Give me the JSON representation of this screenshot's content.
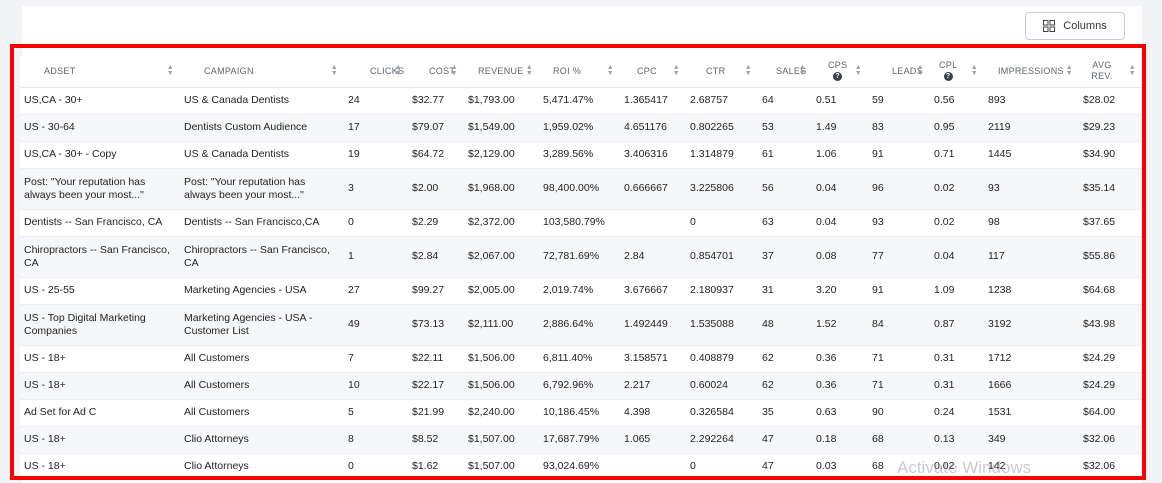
{
  "toolbar": {
    "columns_label": "Columns"
  },
  "watermark": "Activate Windows",
  "table": {
    "headers": {
      "adset": "ADSET",
      "campaign": "CAMPAIGN",
      "clicks": "CLICKS",
      "cost": "COST",
      "revenue": "REVENUE",
      "roi": "ROI %",
      "cpc": "CPC",
      "ctr": "CTR",
      "sales": "SALES",
      "cps": "CPS",
      "leads": "LEADS",
      "cpl": "CPL",
      "impressions": "IMPRESSIONS",
      "avg_rev": "AVG REV."
    },
    "rows": [
      {
        "adset": "US,CA - 30+",
        "campaign": "US & Canada Dentists",
        "clicks": "24",
        "cost": "$32.77",
        "revenue": "$1,793.00",
        "roi": "5,471.47%",
        "cpc": "1.365417",
        "ctr": "2.68757",
        "sales": "64",
        "cps": "0.51",
        "leads": "59",
        "cpl": "0.56",
        "impressions": "893",
        "avg_rev": "$28.02"
      },
      {
        "adset": "US - 30-64",
        "campaign": "Dentists Custom Audience",
        "clicks": "17",
        "cost": "$79.07",
        "revenue": "$1,549.00",
        "roi": "1,959.02%",
        "cpc": "4.651176",
        "ctr": "0.802265",
        "sales": "53",
        "cps": "1.49",
        "leads": "83",
        "cpl": "0.95",
        "impressions": "2119",
        "avg_rev": "$29.23"
      },
      {
        "adset": "US,CA - 30+ - Copy",
        "campaign": "US & Canada Dentists",
        "clicks": "19",
        "cost": "$64.72",
        "revenue": "$2,129.00",
        "roi": "3,289.56%",
        "cpc": "3.406316",
        "ctr": "1.314879",
        "sales": "61",
        "cps": "1.06",
        "leads": "91",
        "cpl": "0.71",
        "impressions": "1445",
        "avg_rev": "$34.90"
      },
      {
        "adset": "Post: \"Your reputation has always been your most...\"",
        "campaign": "Post: \"Your reputation has always been your most...\"",
        "clicks": "3",
        "cost": "$2.00",
        "revenue": "$1,968.00",
        "roi": "98,400.00%",
        "cpc": "0.666667",
        "ctr": "3.225806",
        "sales": "56",
        "cps": "0.04",
        "leads": "96",
        "cpl": "0.02",
        "impressions": "93",
        "avg_rev": "$35.14",
        "tall": true
      },
      {
        "adset": "Dentists -- San Francisco, CA",
        "campaign": "Dentists -- San Francisco,CA",
        "clicks": "0",
        "cost": "$2.29",
        "revenue": "$2,372.00",
        "roi": "103,580.79%",
        "cpc": "",
        "ctr": "0",
        "sales": "63",
        "cps": "0.04",
        "leads": "93",
        "cpl": "0.02",
        "impressions": "98",
        "avg_rev": "$37.65"
      },
      {
        "adset": "Chiropractors -- San Francisco, CA",
        "campaign": "Chiropractors -- San Francisco, CA",
        "clicks": "1",
        "cost": "$2.84",
        "revenue": "$2,067.00",
        "roi": "72,781.69%",
        "cpc": "2.84",
        "ctr": "0.854701",
        "sales": "37",
        "cps": "0.08",
        "leads": "77",
        "cpl": "0.04",
        "impressions": "117",
        "avg_rev": "$55.86",
        "tall": true
      },
      {
        "adset": "US - 25-55",
        "campaign": "Marketing Agencies - USA",
        "clicks": "27",
        "cost": "$99.27",
        "revenue": "$2,005.00",
        "roi": "2,019.74%",
        "cpc": "3.676667",
        "ctr": "2.180937",
        "sales": "31",
        "cps": "3.20",
        "leads": "91",
        "cpl": "1.09",
        "impressions": "1238",
        "avg_rev": "$64.68"
      },
      {
        "adset": "US - Top Digital Marketing Companies",
        "campaign": "Marketing Agencies - USA - Customer List",
        "clicks": "49",
        "cost": "$73.13",
        "revenue": "$2,111.00",
        "roi": "2,886.64%",
        "cpc": "1.492449",
        "ctr": "1.535088",
        "sales": "48",
        "cps": "1.52",
        "leads": "84",
        "cpl": "0.87",
        "impressions": "3192",
        "avg_rev": "$43.98",
        "tall": true
      },
      {
        "adset": "US - 18+",
        "campaign": "All Customers",
        "clicks": "7",
        "cost": "$22.11",
        "revenue": "$1,506.00",
        "roi": "6,811.40%",
        "cpc": "3.158571",
        "ctr": "0.408879",
        "sales": "62",
        "cps": "0.36",
        "leads": "71",
        "cpl": "0.31",
        "impressions": "1712",
        "avg_rev": "$24.29"
      },
      {
        "adset": "US - 18+",
        "campaign": "All Customers",
        "clicks": "10",
        "cost": "$22.17",
        "revenue": "$1,506.00",
        "roi": "6,792.96%",
        "cpc": "2.217",
        "ctr": "0.60024",
        "sales": "62",
        "cps": "0.36",
        "leads": "71",
        "cpl": "0.31",
        "impressions": "1666",
        "avg_rev": "$24.29"
      },
      {
        "adset": "Ad Set for Ad C",
        "campaign": "All Customers",
        "clicks": "5",
        "cost": "$21.99",
        "revenue": "$2,240.00",
        "roi": "10,186.45%",
        "cpc": "4.398",
        "ctr": "0.326584",
        "sales": "35",
        "cps": "0.63",
        "leads": "90",
        "cpl": "0.24",
        "impressions": "1531",
        "avg_rev": "$64.00"
      },
      {
        "adset": "US - 18+",
        "campaign": "Clio Attorneys",
        "clicks": "8",
        "cost": "$8.52",
        "revenue": "$1,507.00",
        "roi": "17,687.79%",
        "cpc": "1.065",
        "ctr": "2.292264",
        "sales": "47",
        "cps": "0.18",
        "leads": "68",
        "cpl": "0.13",
        "impressions": "349",
        "avg_rev": "$32.06"
      },
      {
        "adset": "US - 18+",
        "campaign": "Clio Attorneys",
        "clicks": "0",
        "cost": "$1.62",
        "revenue": "$1,507.00",
        "roi": "93,024.69%",
        "cpc": "",
        "ctr": "0",
        "sales": "47",
        "cps": "0.03",
        "leads": "68",
        "cpl": "0.02",
        "impressions": "142",
        "avg_rev": "$32.06"
      }
    ]
  }
}
